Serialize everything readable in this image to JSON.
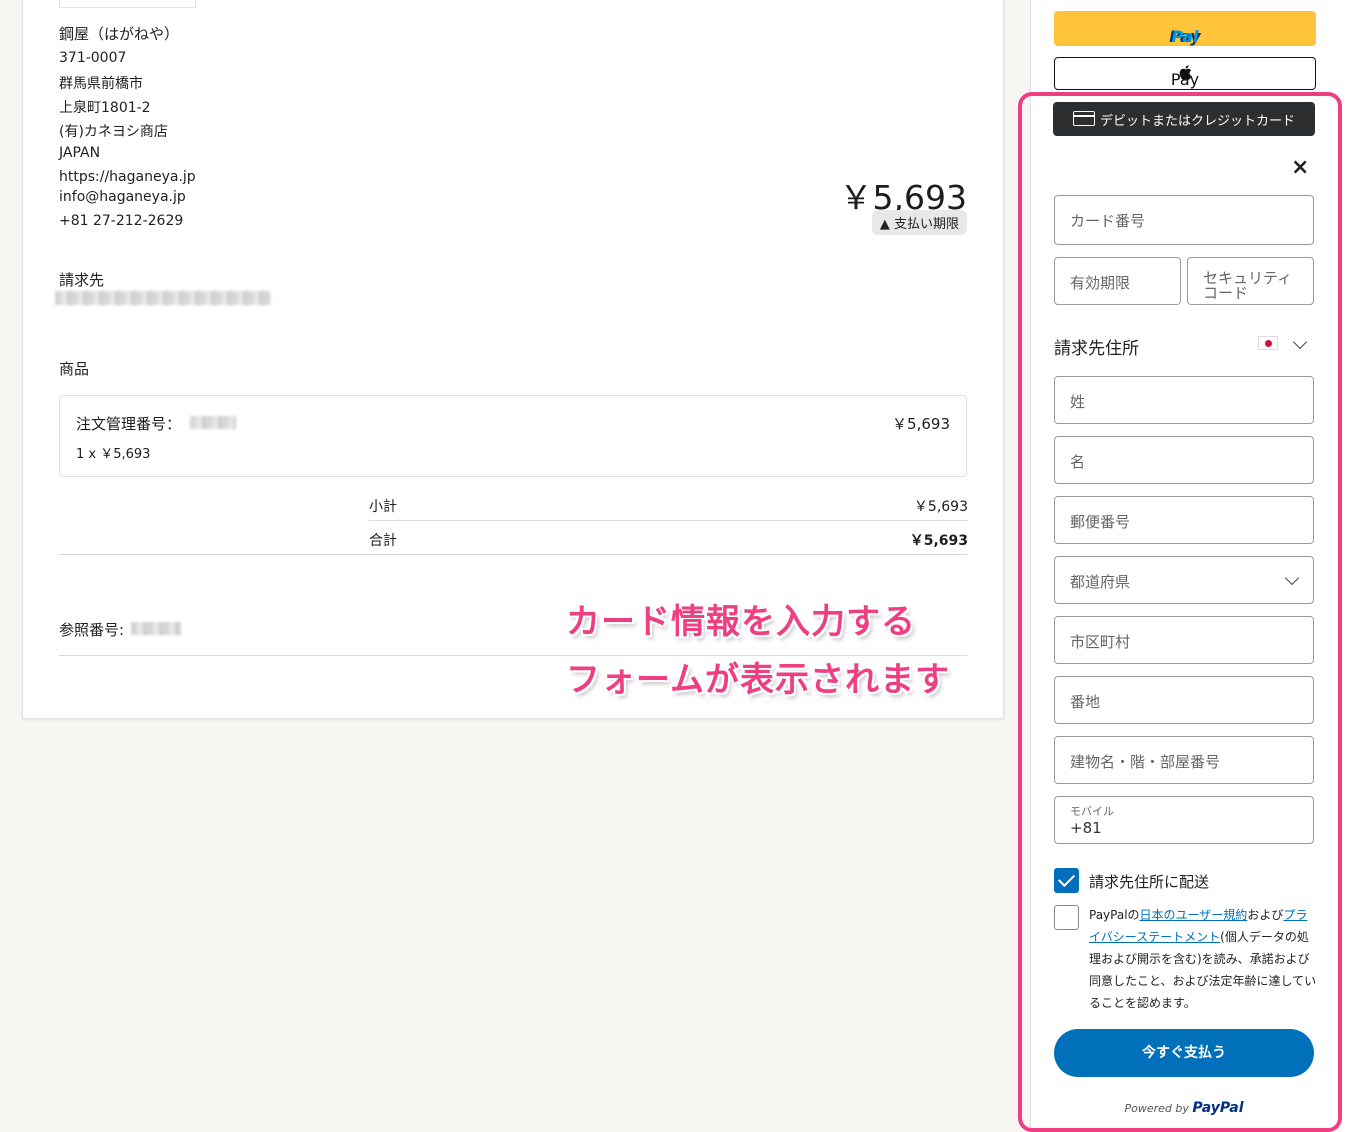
{
  "merchant": {
    "name": "鋼屋（はがねや）",
    "postal": "371-0007",
    "city": "群馬県前橋市",
    "street": "上泉町1801-2",
    "company": "(有)カネヨシ商店",
    "country": "JAPAN",
    "website": "https://haganeya.jp",
    "email": "info@haganeya.jp",
    "phone": "+81 27-212-2629"
  },
  "invoice": {
    "amount_due": "￥5,693",
    "due_badge": "支払い期限",
    "bill_to_label": "請求先",
    "items_label": "商品",
    "item_title": "注文管理番号：",
    "item_qty": "1 x ￥5,693",
    "item_price": "￥5,693",
    "subtotal_label": "小計",
    "subtotal_value": "￥5,693",
    "total_label": "合計",
    "total_value": "￥5,693",
    "reference_label": "参照番号:"
  },
  "annotation": {
    "line1": "カード情報を入力する",
    "line2": "フォームが表示されます",
    "color": "#ee3f83"
  },
  "payment": {
    "paypal_label": "PayPal",
    "applepay_label": "Pay",
    "card_button_label": "デビットまたはクレジットカード",
    "close": "×",
    "card_number_placeholder": "カード番号",
    "expiry_placeholder": "有効期限",
    "cvv_placeholder_1": "セキュリティ",
    "cvv_placeholder_2": "コード",
    "billing_title": "請求先住所",
    "last_name_placeholder": "姓",
    "first_name_placeholder": "名",
    "postal_placeholder": "郵便番号",
    "prefecture_placeholder": "都道府県",
    "city_placeholder": "市区町村",
    "street_placeholder": "番地",
    "building_placeholder": "建物名・階・部屋番号",
    "mobile_label": "モバイル",
    "mobile_value": "+81",
    "ship_same_label": "請求先住所に配送",
    "ship_same_checked": true,
    "terms_prefix": "PayPalの",
    "terms_link1": "日本のユーザー規約",
    "terms_mid": "および",
    "terms_link2": "プライバシーステートメント",
    "terms_suffix": "(個人データの処理および開示を含む)を読み、承諾および同意したこと、および法定年齢に達していることを認めます。",
    "terms_checked": false,
    "pay_now_label": "今すぐ支払う",
    "powered_by": "Powered by",
    "powered_brand": "PayPal",
    "accent_color": "#0070ba"
  }
}
